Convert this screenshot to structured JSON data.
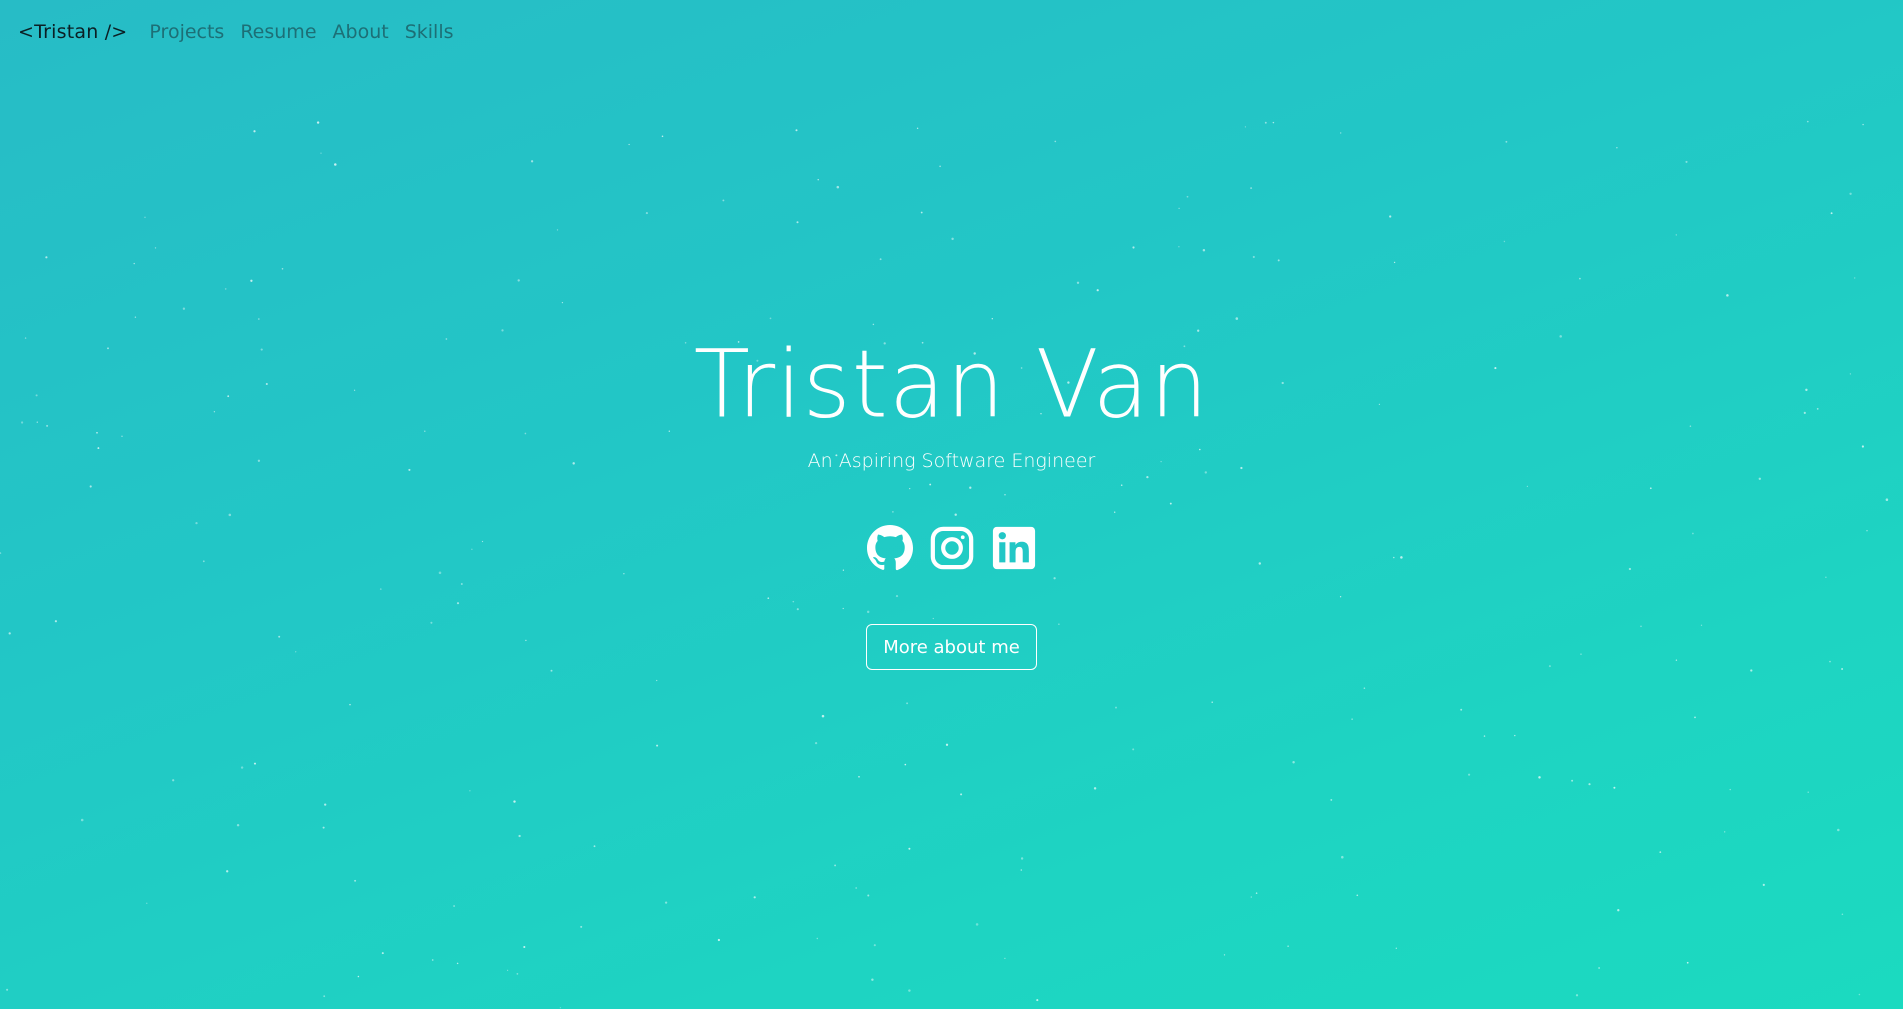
{
  "nav": {
    "brand": "<Tristan />",
    "links": [
      {
        "label": "Projects"
      },
      {
        "label": "Resume"
      },
      {
        "label": "About"
      },
      {
        "label": "Skills"
      }
    ]
  },
  "hero": {
    "name": "Tristan Van",
    "subtitle": "An Aspiring Software Engineer",
    "socials": [
      {
        "icon": "github-icon"
      },
      {
        "icon": "instagram-icon"
      },
      {
        "icon": "linkedin-icon"
      }
    ],
    "cta_label": "More about me"
  },
  "theme": {
    "gradient_start": "#27bcc6",
    "gradient_end": "#1bdac0",
    "text": "#ffffff",
    "nav_link": "#1d6f76",
    "brand": "#0b1f24"
  }
}
